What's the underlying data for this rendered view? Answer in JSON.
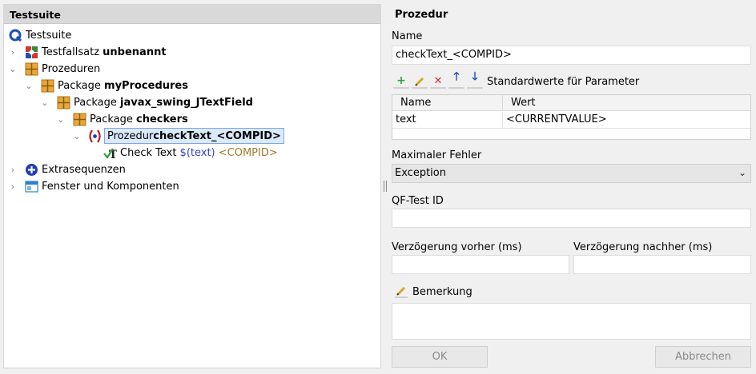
{
  "tree": {
    "header": "Testsuite",
    "nodes": [
      {
        "prefix": "Testsuite",
        "bold": ""
      },
      {
        "prefix": "Testfallsatz ",
        "bold": "unbenannt"
      },
      {
        "prefix": "Prozeduren",
        "bold": ""
      },
      {
        "prefix": "Package ",
        "bold": "myProcedures"
      },
      {
        "prefix": "Package ",
        "bold": "javax_swing_JTextField"
      },
      {
        "prefix": "Package ",
        "bold": "checkers"
      },
      {
        "prefix": "Prozedur ",
        "bold": "checkText_<COMPID>"
      },
      {
        "prefix": "Check Text ",
        "var": "$(text)",
        "comp": " <COMPID>"
      },
      {
        "prefix": "Extrasequenzen",
        "bold": ""
      },
      {
        "prefix": "Fenster und Komponenten",
        "bold": ""
      }
    ]
  },
  "panel": {
    "title": "Prozedur",
    "name_label": "Name",
    "name_value": "checkText_<COMPID>",
    "params_label": "Standardwerte für Parameter",
    "table": {
      "headers": [
        "Name",
        "Wert"
      ],
      "rows": [
        [
          "text",
          "<CURRENTVALUE>"
        ]
      ]
    },
    "max_error_label": "Maximaler Fehler",
    "max_error_value": "Exception",
    "qftest_id_label": "QF-Test ID",
    "delay_before_label": "Verzögerung vorher (ms)",
    "delay_after_label": "Verzögerung nachher (ms)",
    "remark_label": "Bemerkung",
    "ok_label": "OK",
    "cancel_label": "Abbrechen"
  },
  "colors": {
    "selection_bg": "#dbe9fb",
    "selection_border": "#7aa7e0",
    "variable": "#3242c8",
    "component": "#a0782a"
  }
}
